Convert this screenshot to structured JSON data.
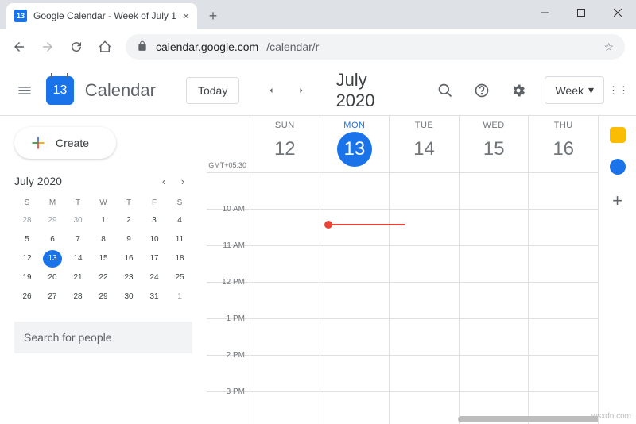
{
  "browser": {
    "tab_title": "Google Calendar - Week of July 1",
    "tab_favicon_text": "13",
    "url_host": "calendar.google.com",
    "url_path": "/calendar/r"
  },
  "header": {
    "logo_text": "13",
    "app_name": "Calendar",
    "today_label": "Today",
    "month_label": "July 2020",
    "view_label": "Week"
  },
  "sidebar": {
    "create_label": "Create",
    "mini_month": "July 2020",
    "dow": [
      "S",
      "M",
      "T",
      "W",
      "T",
      "F",
      "S"
    ],
    "days": [
      {
        "n": 28,
        "out": true
      },
      {
        "n": 29,
        "out": true
      },
      {
        "n": 30,
        "out": true
      },
      {
        "n": 1
      },
      {
        "n": 2
      },
      {
        "n": 3
      },
      {
        "n": 4
      },
      {
        "n": 5
      },
      {
        "n": 6
      },
      {
        "n": 7
      },
      {
        "n": 8
      },
      {
        "n": 9
      },
      {
        "n": 10
      },
      {
        "n": 11
      },
      {
        "n": 12
      },
      {
        "n": 13,
        "today": true
      },
      {
        "n": 14
      },
      {
        "n": 15
      },
      {
        "n": 16
      },
      {
        "n": 17
      },
      {
        "n": 18
      },
      {
        "n": 19
      },
      {
        "n": 20
      },
      {
        "n": 21
      },
      {
        "n": 22
      },
      {
        "n": 23
      },
      {
        "n": 24
      },
      {
        "n": 25
      },
      {
        "n": 26
      },
      {
        "n": 27
      },
      {
        "n": 28
      },
      {
        "n": 29
      },
      {
        "n": 30
      },
      {
        "n": 31
      },
      {
        "n": 1,
        "out": true
      }
    ],
    "search_placeholder": "Search for people"
  },
  "calendar": {
    "timezone": "GMT+05:30",
    "days": [
      {
        "dow": "SUN",
        "num": "12",
        "today": false
      },
      {
        "dow": "MON",
        "num": "13",
        "today": true
      },
      {
        "dow": "TUE",
        "num": "14",
        "today": false
      },
      {
        "dow": "WED",
        "num": "15",
        "today": false
      },
      {
        "dow": "THU",
        "num": "16",
        "today": false
      }
    ],
    "hours": [
      "",
      "10 AM",
      "11 AM",
      "12 PM",
      "1 PM",
      "2 PM",
      "3 PM"
    ]
  },
  "watermark": "wsxdn.com"
}
